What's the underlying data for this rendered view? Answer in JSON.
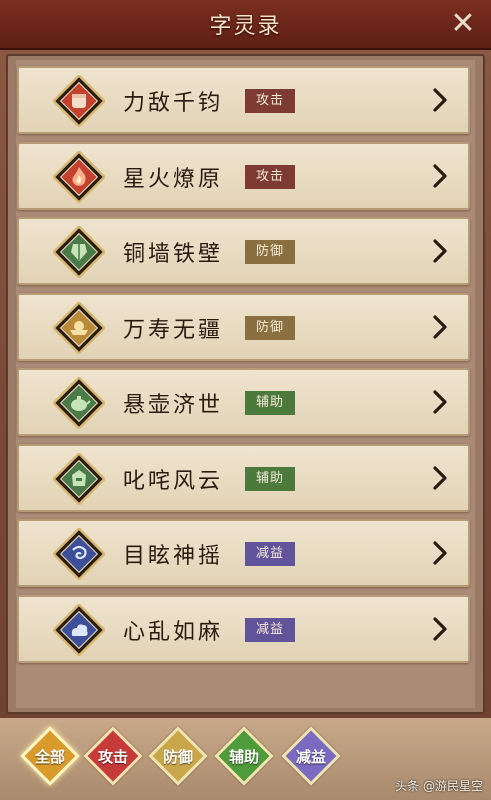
{
  "header": {
    "title": "字灵录"
  },
  "skills": [
    {
      "name": "力敌千钧",
      "tag": "攻击",
      "tag_type": "attack",
      "icon": "fist-icon",
      "icon_color": "#c2412f"
    },
    {
      "name": "星火燎原",
      "tag": "攻击",
      "tag_type": "attack",
      "icon": "fire-icon",
      "icon_color": "#c2412f"
    },
    {
      "name": "铜墙铁壁",
      "tag": "防御",
      "tag_type": "defense",
      "icon": "armor-icon",
      "icon_color": "#4a7a4a"
    },
    {
      "name": "万寿无疆",
      "tag": "防御",
      "tag_type": "defense",
      "icon": "ingot-icon",
      "icon_color": "#b98a3a"
    },
    {
      "name": "悬壶济世",
      "tag": "辅助",
      "tag_type": "support",
      "icon": "teapot-icon",
      "icon_color": "#4a7a4a"
    },
    {
      "name": "叱咤风云",
      "tag": "辅助",
      "tag_type": "support",
      "icon": "helmet-icon",
      "icon_color": "#4a7a4a"
    },
    {
      "name": "目眩神摇",
      "tag": "减益",
      "tag_type": "debuff",
      "icon": "swirl-icon",
      "icon_color": "#3e4f9a"
    },
    {
      "name": "心乱如麻",
      "tag": "减益",
      "tag_type": "debuff",
      "icon": "cloud-icon",
      "icon_color": "#3e4f9a"
    }
  ],
  "filters": [
    {
      "label": "全部",
      "color": "#d89a2a",
      "active": true
    },
    {
      "label": "攻击",
      "color": "#c63a3a",
      "active": false
    },
    {
      "label": "防御",
      "color": "#c9a64a",
      "active": false
    },
    {
      "label": "辅助",
      "color": "#4f9a3a",
      "active": false
    },
    {
      "label": "减益",
      "color": "#7a6ac0",
      "active": false
    }
  ],
  "watermark": "头条 @游民星空"
}
